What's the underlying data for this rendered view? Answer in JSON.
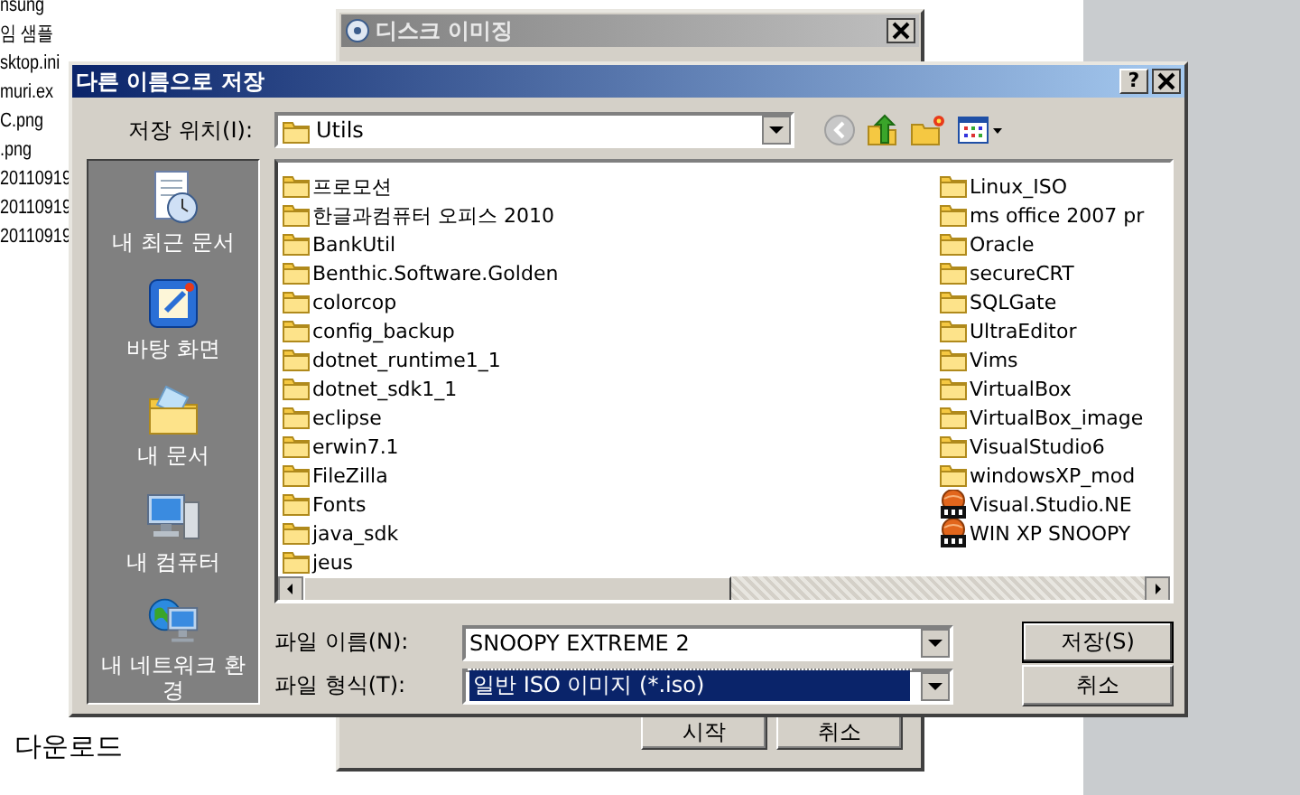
{
  "background_files": [
    "nsung",
    "임 샘플",
    "sktop.ini",
    "muri.ex",
    "C.png",
    ".png",
    "20110919",
    "20110919",
    "20110919"
  ],
  "desktop_label": "다운로드",
  "imaging_window": {
    "title": "디스크 이미징",
    "buttons": [
      "시작",
      "취소"
    ]
  },
  "save_dialog": {
    "title": "다른 이름으로 저장",
    "help_button": "?",
    "location": {
      "label": "저장 위치(I):",
      "value": "Utils"
    },
    "places": [
      "내 최근 문서",
      "바탕 화면",
      "내 문서",
      "내 컴퓨터",
      "내 네트워크 환경"
    ],
    "files": [
      {
        "name": "프로모션",
        "kind": "folder"
      },
      {
        "name": "한글과컴퓨터 오피스 2010",
        "kind": "folder"
      },
      {
        "name": "BankUtil",
        "kind": "folder"
      },
      {
        "name": "Benthic.Software.Golden",
        "kind": "folder"
      },
      {
        "name": "colorcop",
        "kind": "folder"
      },
      {
        "name": "config_backup",
        "kind": "folder"
      },
      {
        "name": "dotnet_runtime1_1",
        "kind": "folder"
      },
      {
        "name": "dotnet_sdk1_1",
        "kind": "folder"
      },
      {
        "name": "eclipse",
        "kind": "folder"
      },
      {
        "name": "erwin7.1",
        "kind": "folder"
      },
      {
        "name": "FileZilla",
        "kind": "folder"
      },
      {
        "name": "Fonts",
        "kind": "folder"
      },
      {
        "name": "java_sdk",
        "kind": "folder"
      },
      {
        "name": "jeus",
        "kind": "folder"
      },
      {
        "name": "Linux_ISO",
        "kind": "folder"
      },
      {
        "name": "ms office 2007 pr",
        "kind": "folder"
      },
      {
        "name": "Oracle",
        "kind": "folder"
      },
      {
        "name": "secureCRT",
        "kind": "folder"
      },
      {
        "name": "SQLGate",
        "kind": "folder"
      },
      {
        "name": "UltraEditor",
        "kind": "folder"
      },
      {
        "name": "Vims",
        "kind": "folder"
      },
      {
        "name": "VirtualBox",
        "kind": "folder"
      },
      {
        "name": "VirtualBox_image",
        "kind": "folder"
      },
      {
        "name": "VisualStudio6",
        "kind": "folder"
      },
      {
        "name": "windowsXP_mod",
        "kind": "folder"
      },
      {
        "name": "Visual.Studio.NE",
        "kind": "iso"
      },
      {
        "name": "WIN XP SNOOPY",
        "kind": "iso"
      }
    ],
    "file_name": {
      "label": "파일 이름(N):",
      "value": "SNOOPY EXTREME 2"
    },
    "file_type": {
      "label": "파일 형식(T):",
      "value": "일반 ISO 이미지 (*.iso)",
      "focused": true
    },
    "buttons": [
      "저장(S)",
      "취소"
    ]
  }
}
